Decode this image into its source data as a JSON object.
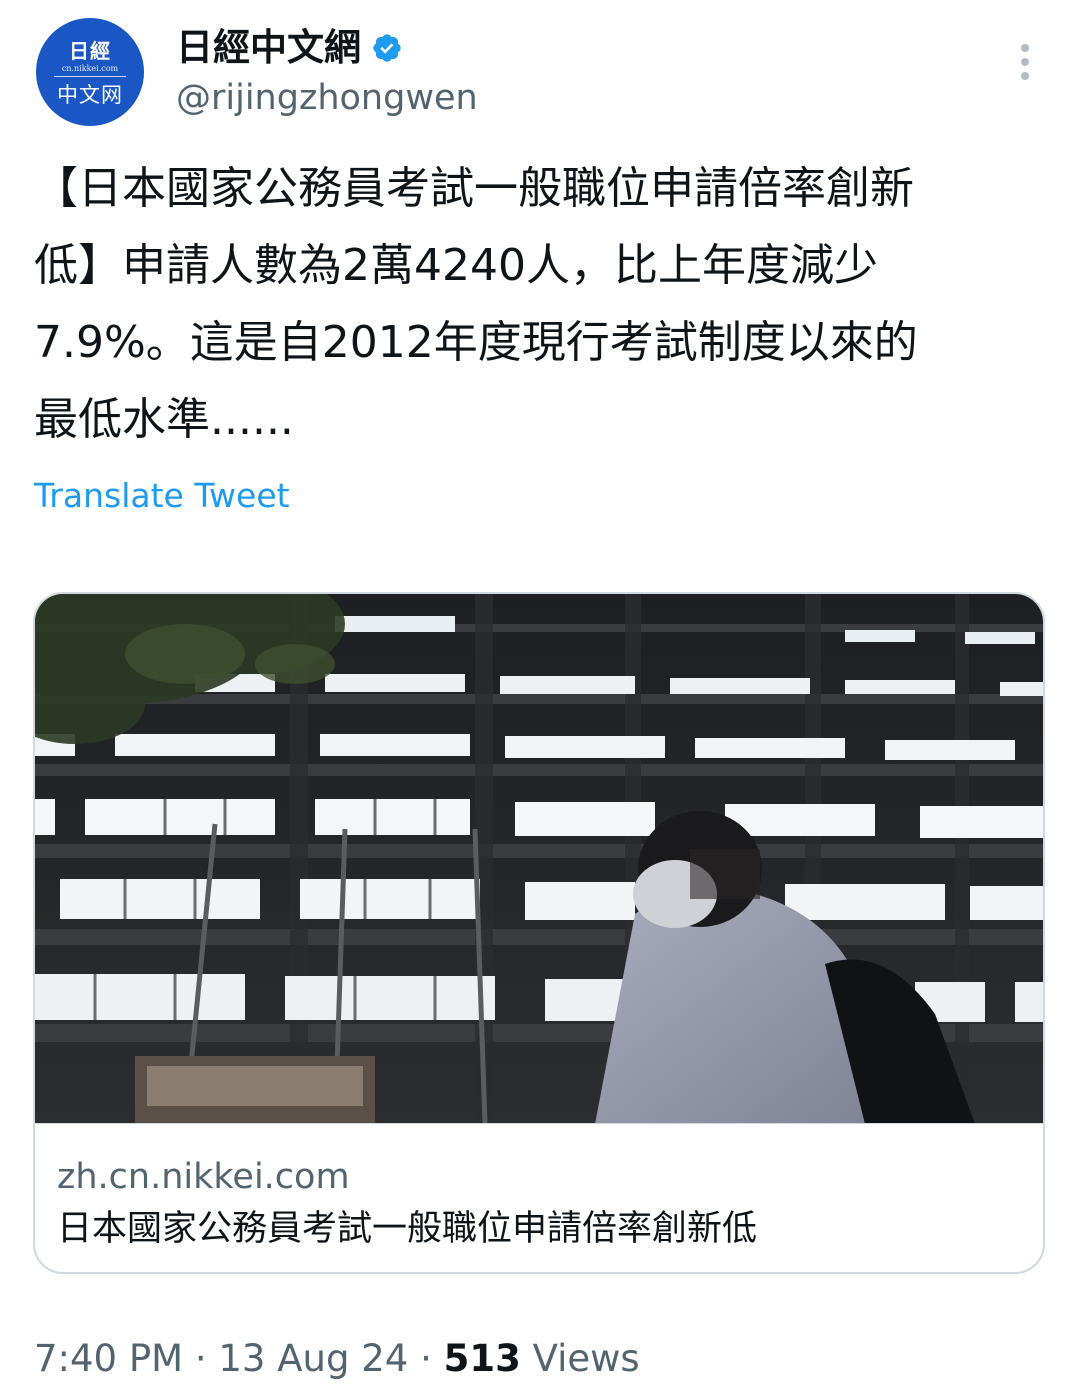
{
  "account": {
    "display_name": "日經中文網",
    "handle": "@rijingzhongwen",
    "verified_icon": "verified-badge-icon",
    "avatar": {
      "logo_top": "日經",
      "logo_url": "cn.nikkei.com",
      "logo_bottom": "中文网",
      "background": "#1a56c4"
    },
    "more_icon": "more-vertical-icon"
  },
  "tweet": {
    "text": "【日本國家公務員考試一般職位申請倍率創新\n低】申請人數為2萬4240人，比上年度減少\n7.9%。這是自2012年度現行考試制度以來的\n最低水準......",
    "translate_label": "Translate Tweet"
  },
  "card": {
    "image_description": "office-building-at-night-photo",
    "domain": "zh.cn.nikkei.com",
    "title": "日本國家公務員考試一般職位申請倍率創新低"
  },
  "meta": {
    "time": "7:40 PM",
    "separator": " · ",
    "date": "13 Aug 24",
    "views_count": "513",
    "views_label": " Views"
  },
  "colors": {
    "link": "#1d9bf0",
    "secondary_text": "#536471",
    "primary_text": "#0f1419",
    "border": "#cfd9de",
    "verified": "#1d9bf0"
  }
}
